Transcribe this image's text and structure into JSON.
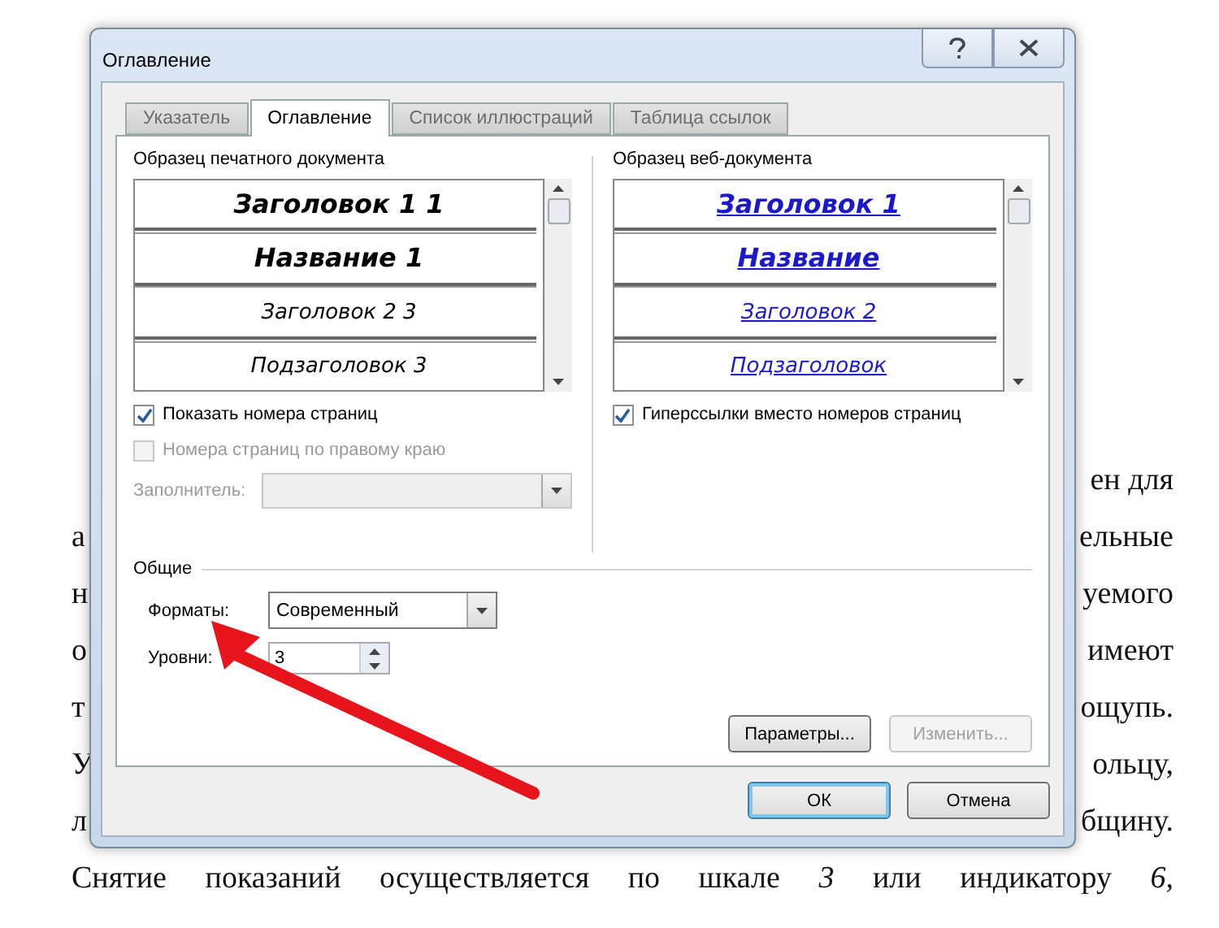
{
  "document": {
    "lines": [
      {
        "right": "ен для"
      },
      {
        "left": "а",
        "right": "ельные"
      },
      {
        "left": "н",
        "right": "уемого"
      },
      {
        "left": "о",
        "right": "имеют"
      },
      {
        "left": "т",
        "right": "ощупь."
      },
      {
        "left": "У",
        "right": "ольцу,"
      },
      {
        "left": "л",
        "right": "бщину."
      }
    ],
    "paragraph": "Снятие показаний осуществляется по шкале *3* или индикатору *6,*"
  },
  "window": {
    "title": "Оглавление"
  },
  "tabs": [
    {
      "label": "Указатель",
      "selected": false
    },
    {
      "label": "Оглавление",
      "selected": true
    },
    {
      "label": "Список иллюстраций",
      "selected": false
    },
    {
      "label": "Таблица ссылок",
      "selected": false
    }
  ],
  "print_preview": {
    "label": "Образец печатного документа",
    "entries": [
      {
        "text": "Заголовок 1 1",
        "kind": "level1"
      },
      {
        "text": "Название 1",
        "kind": "caption"
      },
      {
        "text": "Заголовок 2 3",
        "kind": "level2"
      },
      {
        "text": "Подзаголовок 3",
        "kind": "level3"
      }
    ],
    "options": [
      {
        "label": "Показать номера страниц",
        "checked": true,
        "disabled": false
      },
      {
        "label": "Номера страниц по правому краю",
        "checked": false,
        "disabled": true
      }
    ],
    "leader": {
      "label": "Заполнитель:",
      "disabled": true
    }
  },
  "web_preview": {
    "label": "Образец веб-документа",
    "entries": [
      {
        "text": "Заголовок 1",
        "kind": "level1"
      },
      {
        "text": "Название",
        "kind": "caption"
      },
      {
        "text": "Заголовок 2",
        "kind": "level2"
      },
      {
        "text": "Подзаголовок",
        "kind": "level3"
      }
    ],
    "options": [
      {
        "label": "Гиперссылки вместо номеров страниц",
        "checked": true,
        "disabled": false
      }
    ]
  },
  "general": {
    "label": "Общие",
    "formats": {
      "label": "Форматы:",
      "value": "Современный"
    },
    "levels": {
      "label": "Уровни:",
      "value": "3"
    }
  },
  "buttons": [
    {
      "label": "Параметры...",
      "disabled": false,
      "default": false
    },
    {
      "label": "Изменить...",
      "disabled": true,
      "default": false
    }
  ],
  "footer_buttons": [
    {
      "label": "ОК",
      "disabled": false,
      "default": true
    },
    {
      "label": "Отмена",
      "disabled": false,
      "default": false
    }
  ]
}
